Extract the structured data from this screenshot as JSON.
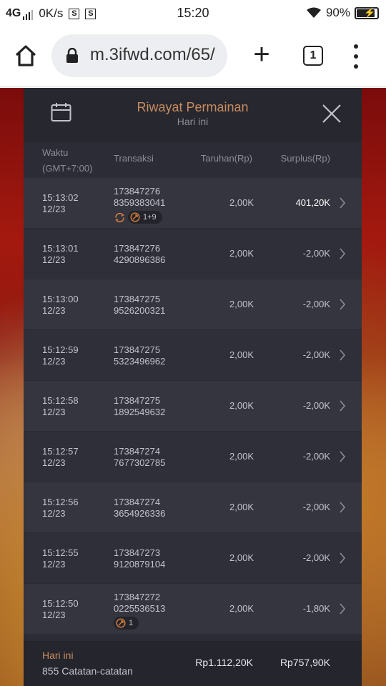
{
  "status": {
    "network": "4G",
    "speed": "0K/s",
    "sim_icons": [
      "S",
      "S"
    ],
    "time": "15:20",
    "battery": "90%"
  },
  "browser": {
    "url": "m.3ifwd.com/65/",
    "tab_count": "1"
  },
  "modal": {
    "title": "Riwayat Permainan",
    "subtitle": "Hari ini",
    "columns": {
      "time_line1": "Waktu",
      "time_line2": "(GMT+7:00)",
      "transaction": "Transaksi",
      "bet": "Taruhan(Rp)",
      "surplus": "Surplus(Rp)"
    },
    "rows": [
      {
        "time": "15:13:02",
        "date": "12/23",
        "tx1": "173847276",
        "tx2": "8359383041",
        "bet": "2,00K",
        "surplus": "401,20K",
        "positive": true,
        "badge": "1+9",
        "spin": true
      },
      {
        "time": "15:13:01",
        "date": "12/23",
        "tx1": "173847276",
        "tx2": "4290896386",
        "bet": "2,00K",
        "surplus": "-2,00K"
      },
      {
        "time": "15:13:00",
        "date": "12/23",
        "tx1": "173847275",
        "tx2": "9526200321",
        "bet": "2,00K",
        "surplus": "-2,00K"
      },
      {
        "time": "15:12:59",
        "date": "12/23",
        "tx1": "173847275",
        "tx2": "5323496962",
        "bet": "2,00K",
        "surplus": "-2,00K"
      },
      {
        "time": "15:12:58",
        "date": "12/23",
        "tx1": "173847275",
        "tx2": "1892549632",
        "bet": "2,00K",
        "surplus": "-2,00K"
      },
      {
        "time": "15:12:57",
        "date": "12/23",
        "tx1": "173847274",
        "tx2": "7677302785",
        "bet": "2,00K",
        "surplus": "-2,00K"
      },
      {
        "time": "15:12:56",
        "date": "12/23",
        "tx1": "173847274",
        "tx2": "3654926336",
        "bet": "2,00K",
        "surplus": "-2,00K"
      },
      {
        "time": "15:12:55",
        "date": "12/23",
        "tx1": "173847273",
        "tx2": "9120879104",
        "bet": "2,00K",
        "surplus": "-2,00K"
      },
      {
        "time": "15:12:50",
        "date": "12/23",
        "tx1": "173847272",
        "tx2": "0225536513",
        "bet": "2,00K",
        "surplus": "-1,80K",
        "badge": "1"
      }
    ],
    "footer": {
      "label": "Hari ini",
      "count": "855 Catatan-catatan",
      "total_bet": "Rp1.112,20K",
      "total_surplus": "Rp757,90K"
    }
  },
  "colors": {
    "accent": "#c98b5d",
    "panel": "#2b2c35",
    "spin_icon": "#d9803a"
  }
}
